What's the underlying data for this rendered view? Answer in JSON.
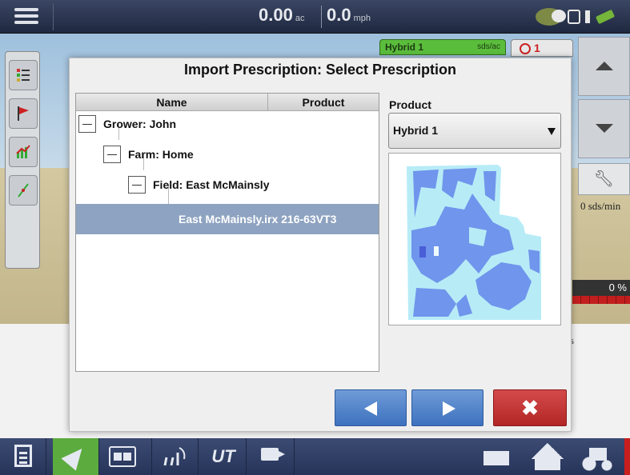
{
  "topbar": {
    "area_value": "0.00",
    "area_unit": "ac",
    "speed_value": "0.0",
    "speed_unit": "mph",
    "icons": [
      "menu-icon",
      "leaf-status-icon",
      "display-icon",
      "bars-icon",
      "gps-signal-icon"
    ]
  },
  "map_overlay": {
    "product_tab": "Hybrid 1",
    "product_unit": "sds/ac",
    "alarm_count": "1",
    "rate_label": "0 sds/min",
    "percent_label": "0 %",
    "lower_text": "s"
  },
  "dialog": {
    "title": "Import Prescription: Select Prescription",
    "columns": {
      "name": "Name",
      "product": "Product"
    },
    "tree": {
      "grower": "Grower:  John",
      "farm": "Farm: Home",
      "field": "Field: East McMainsly",
      "prescription": "East McMainsly.irx 216-63VT3"
    },
    "product_label": "Product",
    "product_selected": "Hybrid 1",
    "close_label": "✖"
  },
  "colors": {
    "selected_row": "#8ea3c1",
    "nav_button": "#4a7fc6",
    "close_button": "#c23333",
    "map_light": "#b7ecf7",
    "map_dark": "#6f95ec",
    "accent_green": "#5bab3f"
  },
  "bottombar": {
    "icons": [
      "document-icon",
      "navigation-icon",
      "split-view-icon",
      "plant-icon",
      "ut-icon",
      "camera-icon",
      "truck-icon",
      "shed-icon",
      "tractor-icon"
    ],
    "ut_label": "UT"
  }
}
